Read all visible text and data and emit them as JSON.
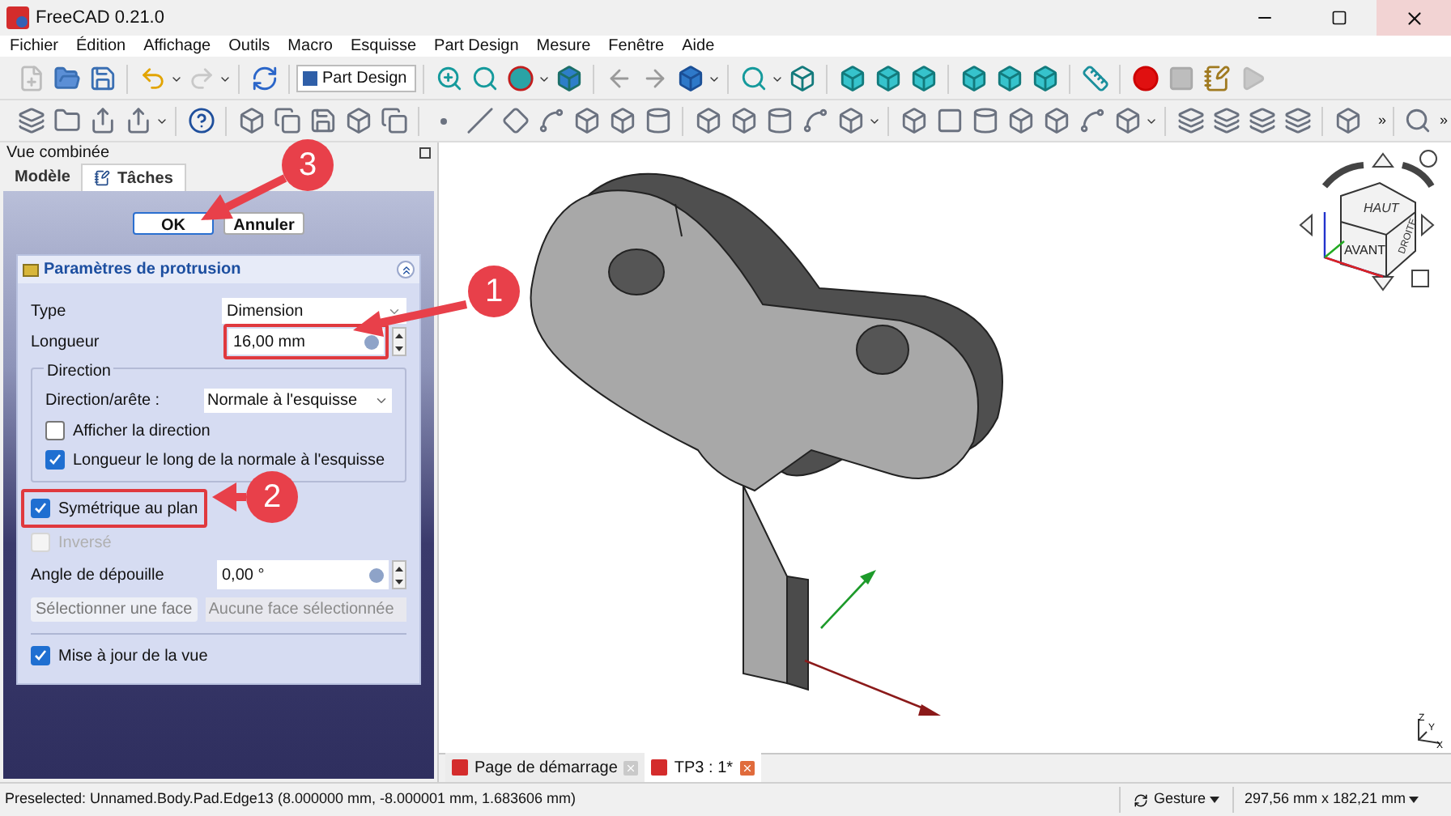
{
  "window": {
    "title": "FreeCAD 0.21.0"
  },
  "menu": [
    "Fichier",
    "Édition",
    "Affichage",
    "Outils",
    "Macro",
    "Esquisse",
    "Part Design",
    "Mesure",
    "Fenêtre",
    "Aide"
  ],
  "workbench": {
    "value": "Part Design"
  },
  "toolbar_overflow": [
    "»",
    "»"
  ],
  "combo_view": {
    "title": "Vue combinée",
    "tabs": [
      {
        "label": "Modèle",
        "selected": false
      },
      {
        "label": "Tâches",
        "selected": true
      }
    ],
    "buttons": [
      "OK",
      "Annuler"
    ],
    "section": {
      "title": "Paramètres de protrusion",
      "type": {
        "label": "Type",
        "value": "Dimension"
      },
      "length": {
        "label": "Longueur",
        "value": "16,00 mm"
      },
      "direction": {
        "title": "Direction",
        "label": "Direction/arête :",
        "value": "Normale à l'esquisse",
        "checks": [
          {
            "label": "Afficher la direction",
            "checked": false
          },
          {
            "label": "Longueur le long de la normale à l'esquisse",
            "checked": true
          }
        ]
      },
      "checks": [
        {
          "label": "Symétrique au plan",
          "checked": true,
          "disabled": false
        },
        {
          "label": "Inversé",
          "checked": false,
          "disabled": true
        }
      ],
      "taper": {
        "label": "Angle de dépouille",
        "value": "0,00 °"
      },
      "select_face": {
        "button": "Sélectionner une face",
        "placeholder": "Aucune face sélectionnée"
      },
      "update_view": {
        "label": "Mise à jour de la vue",
        "checked": true
      }
    }
  },
  "annotations": [
    {
      "label": "1"
    },
    {
      "label": "2"
    },
    {
      "label": "3"
    }
  ],
  "nav_cube": {
    "faces": [
      "HAUT",
      "AVANT",
      "DROITE"
    ]
  },
  "axis_labels": [
    "Z",
    "Y",
    "X"
  ],
  "document_tabs": [
    {
      "label": "Page de démarrage",
      "selected": false
    },
    {
      "label": "TP3 : 1*",
      "selected": true
    }
  ],
  "status_bar": {
    "message": "Preselected: Unnamed.Body.Pad.Edge13 (8.000000 mm, -8.000001 mm, 1.683606 mm)",
    "navigation": "Gesture",
    "dimensions": "297,56 mm x 182,21 mm"
  }
}
